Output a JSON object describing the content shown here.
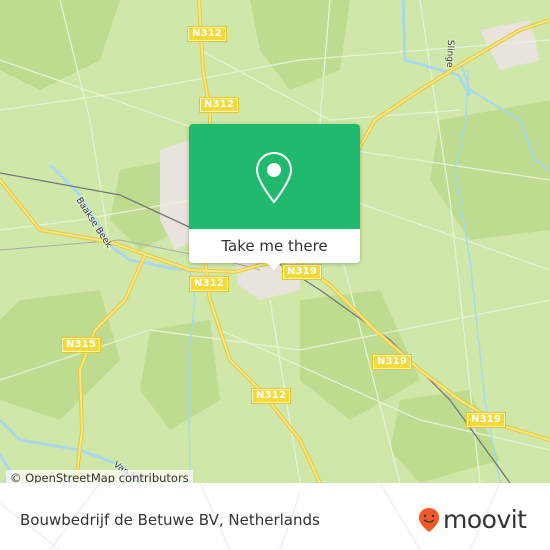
{
  "map": {
    "road_labels": [
      {
        "id": "n312-top",
        "text": "N312"
      },
      {
        "id": "n312-mid",
        "text": "N312"
      },
      {
        "id": "n312-town",
        "text": "N312"
      },
      {
        "id": "n312-south",
        "text": "N312"
      },
      {
        "id": "n319-town",
        "text": "N319"
      },
      {
        "id": "n319-mid",
        "text": "N319"
      },
      {
        "id": "n319-east",
        "text": "N319"
      },
      {
        "id": "n315",
        "text": "N315"
      }
    ],
    "water_labels": [
      {
        "id": "baakse-beek",
        "text": "Baakse Beek"
      },
      {
        "id": "slinge",
        "text": "Slinge"
      },
      {
        "id": "van-h",
        "text": "Van H..."
      }
    ],
    "colors": {
      "land": "#cfe8a9",
      "forest": "#bddc8f",
      "road": "#f3da3c",
      "water": "#a8d8ea",
      "rail": "#777777",
      "accent": "#20ba6e",
      "brand": "#f05a28"
    }
  },
  "popup": {
    "icon": "map-pin-icon",
    "button_label": "Take me there"
  },
  "attribution": "© OpenStreetMap contributors",
  "footer": {
    "place_name": "Bouwbedrijf de Betuwe BV, Netherlands",
    "brand_name": "moovit",
    "brand_icon": "moovit-smiley-pin-icon"
  }
}
